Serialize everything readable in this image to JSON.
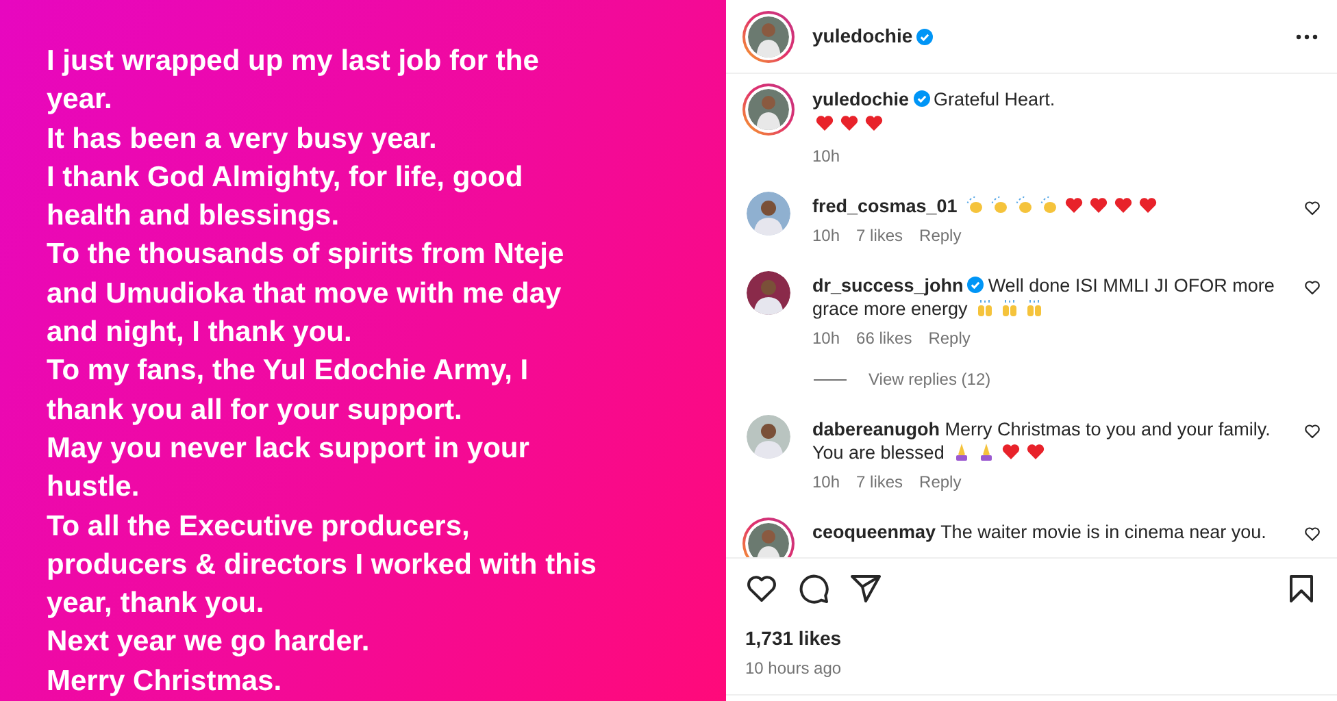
{
  "post_image": {
    "lines": [
      "I just wrapped up my last job for the",
      "year.",
      "It has been a very busy year.",
      "I thank God Almighty, for life, good",
      "health and blessings.",
      "To the thousands of spirits from Nteje",
      "and Umudioka that move with me day",
      "and night, I thank you.",
      "To my fans, the Yul Edochie Army, I",
      "thank you all for your support.",
      "May you never lack support in your",
      "hustle.",
      "To all the Executive producers,",
      "producers & directors I worked with this",
      "year, thank you.",
      "Next year we go harder.",
      "Merry Christmas."
    ]
  },
  "header": {
    "username": "yuledochie",
    "verified": true
  },
  "caption": {
    "username": "yuledochie",
    "verified": true,
    "text": "Grateful Heart.",
    "emojis": [
      {
        "kind": "heart"
      },
      {
        "kind": "heart"
      },
      {
        "kind": "heart"
      }
    ],
    "time": "10h"
  },
  "comments": [
    {
      "username": "fred_cosmas_01",
      "verified": false,
      "story_ring": false,
      "emojis": [
        {
          "kind": "clap"
        },
        {
          "kind": "clap"
        },
        {
          "kind": "clap"
        },
        {
          "kind": "clap"
        },
        {
          "kind": "heart"
        },
        {
          "kind": "heart"
        },
        {
          "kind": "heart"
        },
        {
          "kind": "heart"
        }
      ],
      "time": "10h",
      "likes": "7 likes",
      "reply": "Reply"
    },
    {
      "username": "dr_success_john",
      "verified": true,
      "story_ring": false,
      "text": "Well done ISI MMLI JI OFOR more grace more energy",
      "emojis": [
        {
          "kind": "raised-hands"
        },
        {
          "kind": "raised-hands"
        },
        {
          "kind": "raised-hands"
        }
      ],
      "time": "10h",
      "likes": "66 likes",
      "reply": "Reply",
      "view_replies": "View replies (12)"
    },
    {
      "username": "dabereanugoh",
      "verified": false,
      "story_ring": false,
      "text": "Merry Christmas to you and your family. You are blessed",
      "emojis": [
        {
          "kind": "pray"
        },
        {
          "kind": "pray"
        },
        {
          "kind": "heart"
        },
        {
          "kind": "heart"
        }
      ],
      "time": "10h",
      "likes": "7 likes",
      "reply": "Reply"
    },
    {
      "username": "ceoqueenmay",
      "verified": false,
      "text": "The waiter movie is in cinema near you.",
      "story_ring": true
    }
  ],
  "likes": "1,731 likes",
  "posted": "10 hours ago"
}
